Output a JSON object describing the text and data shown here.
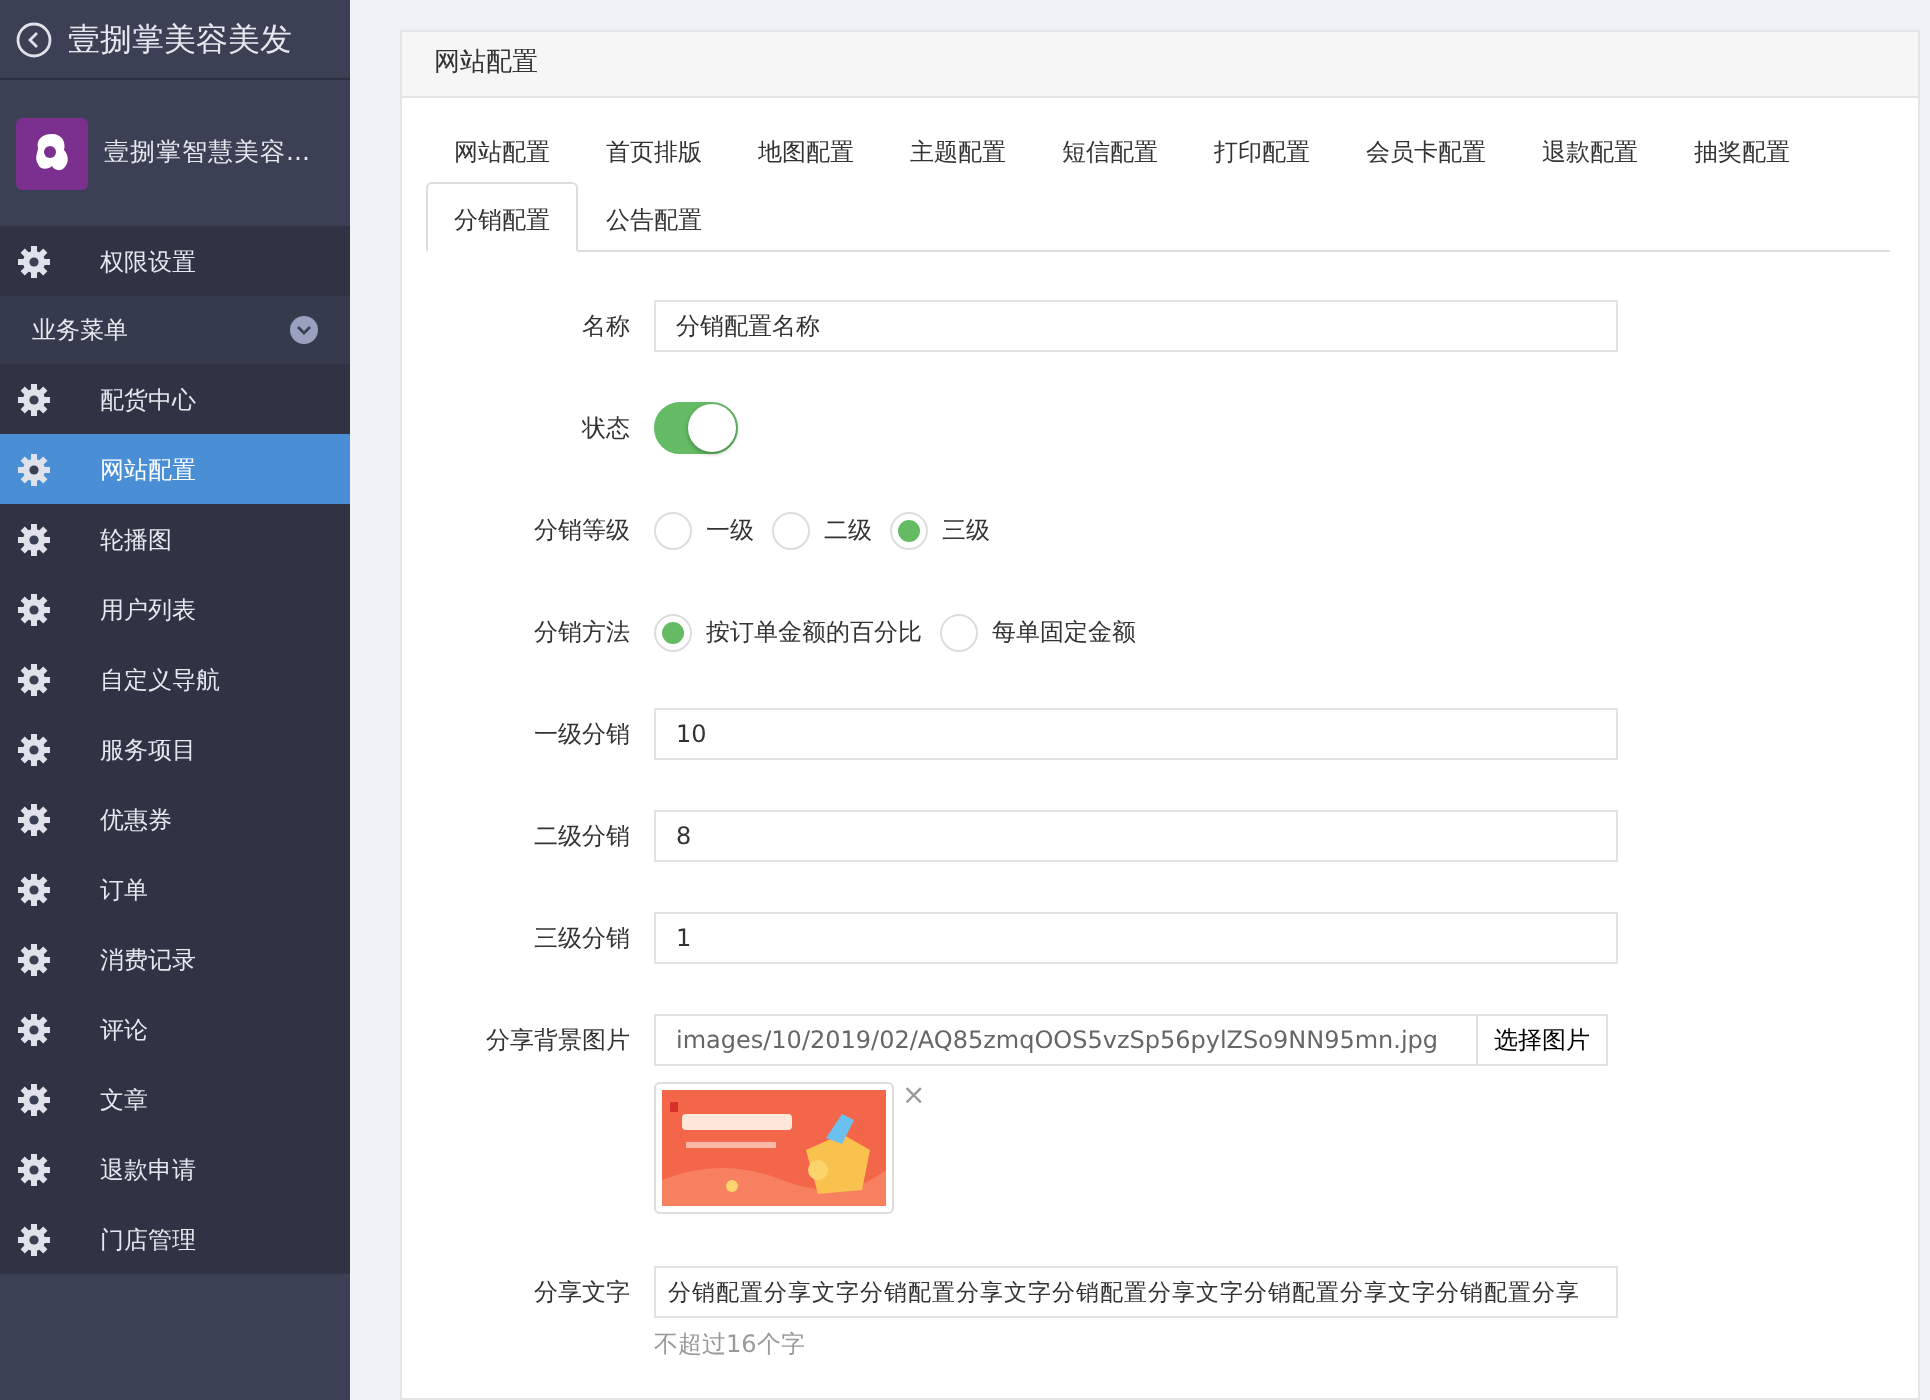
{
  "sidebar": {
    "title": "壹捌掌美容美发",
    "profile_name": "壹捌掌智慧美容...",
    "items": [
      {
        "label": "权限设置",
        "selected": false
      }
    ],
    "group": {
      "label": "业务菜单",
      "expanded": true,
      "items": [
        {
          "label": "配货中心",
          "selected": false
        },
        {
          "label": "网站配置",
          "selected": true
        },
        {
          "label": "轮播图",
          "selected": false
        },
        {
          "label": "用户列表",
          "selected": false
        },
        {
          "label": "自定义导航",
          "selected": false
        },
        {
          "label": "服务项目",
          "selected": false
        },
        {
          "label": "优惠券",
          "selected": false
        },
        {
          "label": "订单",
          "selected": false
        },
        {
          "label": "消费记录",
          "selected": false
        },
        {
          "label": "评论",
          "selected": false
        },
        {
          "label": "文章",
          "selected": false
        },
        {
          "label": "退款申请",
          "selected": false
        },
        {
          "label": "门店管理",
          "selected": false
        }
      ]
    }
  },
  "panel": {
    "title": "网站配置",
    "tabs": [
      {
        "label": "网站配置",
        "selected": false
      },
      {
        "label": "首页排版",
        "selected": false
      },
      {
        "label": "地图配置",
        "selected": false
      },
      {
        "label": "主题配置",
        "selected": false
      },
      {
        "label": "短信配置",
        "selected": false
      },
      {
        "label": "打印配置",
        "selected": false
      },
      {
        "label": "会员卡配置",
        "selected": false
      },
      {
        "label": "退款配置",
        "selected": false
      },
      {
        "label": "抽奖配置",
        "selected": false
      },
      {
        "label": "分销配置",
        "selected": true
      },
      {
        "label": "公告配置",
        "selected": false
      }
    ],
    "fields": [
      {
        "kind": "text",
        "label": "名称",
        "value": "分销配置名称"
      },
      {
        "kind": "switch",
        "label": "状态",
        "on": true
      },
      {
        "kind": "radio",
        "label": "分销等级",
        "options": [
          {
            "label": "一级",
            "selected": false
          },
          {
            "label": "二级",
            "selected": false
          },
          {
            "label": "三级",
            "selected": true
          }
        ]
      },
      {
        "kind": "radio",
        "label": "分销方法",
        "options": [
          {
            "label": "按订单金额的百分比",
            "selected": true
          },
          {
            "label": "每单固定金额",
            "selected": false
          }
        ]
      },
      {
        "kind": "text",
        "label": "一级分销",
        "value": "10"
      },
      {
        "kind": "text",
        "label": "二级分销",
        "value": "8"
      },
      {
        "kind": "text",
        "label": "三级分销",
        "value": "1"
      },
      {
        "label": "分享背景图片",
        "value": "images/10/2019/02/AQ85zmqOOS5vzSp56pylZSo9NN95mn.jpg",
        "button": "选择图片",
        "remove": "×"
      },
      {
        "kind": "text",
        "label": "分享文字",
        "value": "分销配置分享文字分销配置分享文字分销配置分享文字分销配置分享文字分销配置分享",
        "help": "不超过16个字"
      }
    ]
  }
}
